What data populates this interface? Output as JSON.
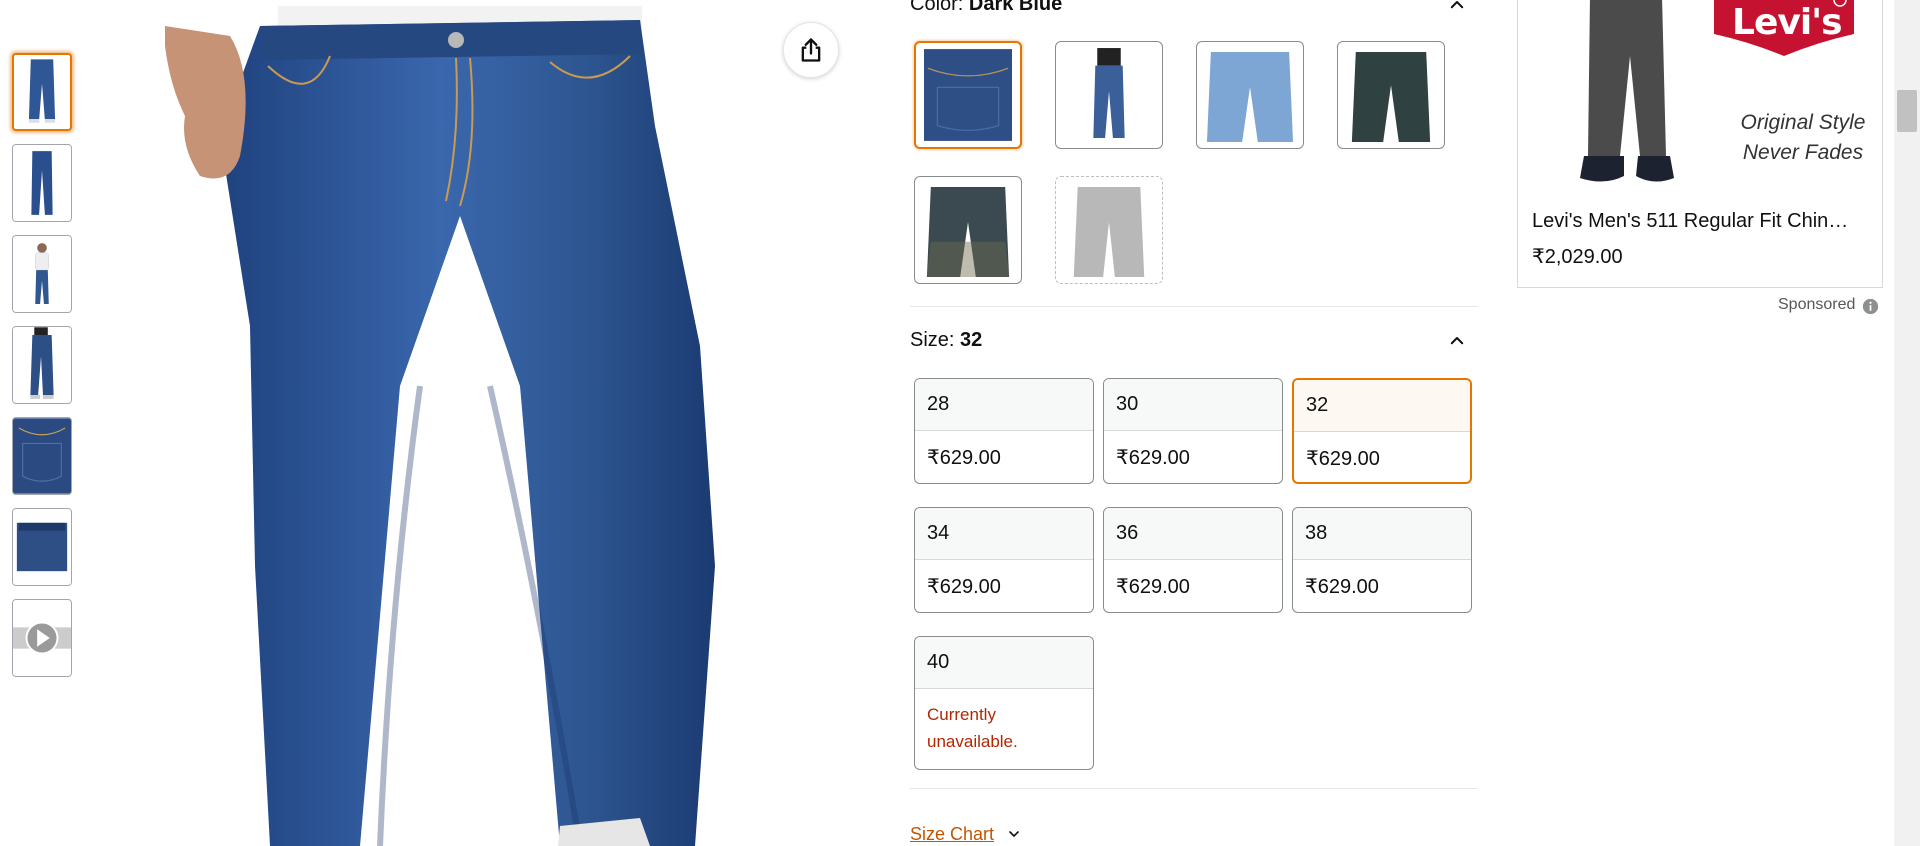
{
  "color": {
    "label": "Color: ",
    "value": "Dark Blue",
    "swatch_count": 6,
    "selected_index": 0,
    "unavailable_index": 5
  },
  "size": {
    "label": "Size: ",
    "value": "32",
    "options": [
      {
        "size": "28",
        "price": "₹629.00"
      },
      {
        "size": "30",
        "price": "₹629.00"
      },
      {
        "size": "32",
        "price": "₹629.00"
      },
      {
        "size": "34",
        "price": "₹629.00"
      },
      {
        "size": "36",
        "price": "₹629.00"
      },
      {
        "size": "38",
        "price": "₹629.00"
      },
      {
        "size": "40",
        "unavailable": "Currently unavailable."
      }
    ],
    "selected_size": "32"
  },
  "size_chart": {
    "label": "Size Chart"
  },
  "ad": {
    "brand": "Levi's",
    "tagline": "Original Style Never Fades",
    "title": "Levi's Men's 511 Regular Fit Chin…",
    "price": "₹2,029.00",
    "sponsored_label": "Sponsored"
  },
  "icons": {
    "share": "share-icon",
    "collapse": "chevron-up-icon",
    "info": "info-icon",
    "play": "play-icon"
  },
  "colors": {
    "accent_selected": "#e77600",
    "link": "#c45500",
    "unavailable_text": "#b12704",
    "levis_red": "#c41230"
  }
}
